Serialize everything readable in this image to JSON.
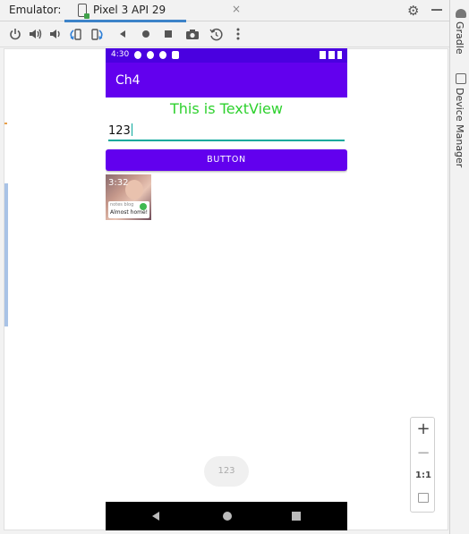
{
  "ide": {
    "tool_window_title": "Emulator:",
    "device_tab": {
      "label": "Pixel 3 API 29",
      "close": "×"
    },
    "right_strip": [
      "Gradle",
      "Device Manager"
    ],
    "colors": {
      "accent": "#3d83c9",
      "panel_bg": "#f2f2f2"
    },
    "toolbar_icons": [
      "power-icon",
      "volume-up-icon",
      "volume-down-icon",
      "rotate-left-icon",
      "rotate-right-icon",
      "back-icon",
      "home-icon",
      "overview-icon",
      "screenshot-icon",
      "snapshot-icon",
      "more-icon"
    ]
  },
  "device": {
    "status_bar": {
      "time": "4:30"
    },
    "app_bar": {
      "title": "Ch4"
    },
    "text_view": {
      "text": "This is TextView",
      "color": "#2ed12e"
    },
    "edit_text": {
      "value": "123"
    },
    "button": {
      "label": "BUTTON",
      "color": "#6200ee"
    },
    "thumbnail": {
      "clock": "3:32",
      "line1": "notes blog",
      "line2": "Almost home!"
    },
    "toast": {
      "text": "123"
    }
  },
  "zoom_controls": {
    "zoom_in": "+",
    "zoom_out": "−",
    "actual_size": "1:1"
  }
}
